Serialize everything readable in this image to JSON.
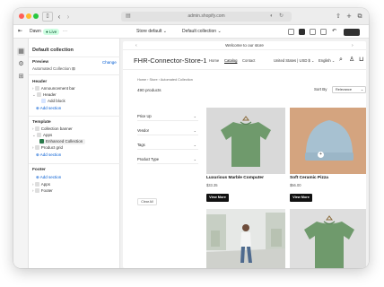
{
  "browser": {
    "url": "admin.shopify.com",
    "back_icon": "chevron-left-icon",
    "forward_icon": "chevron-right-icon",
    "sidebar_toggle_icon": "sidebar-icon",
    "share_icon": "share-icon",
    "new_tab_icon": "plus-icon",
    "tabs_icon": "tabs-overview-icon"
  },
  "toolbar": {
    "theme_name": "Dawn",
    "live_badge": "● Live",
    "more_label": "···",
    "store_selector": "Store default ⌄",
    "template_selector": "Default collection ⌄"
  },
  "rail": {
    "icons": [
      "sections-icon",
      "settings-icon",
      "apps-icon"
    ]
  },
  "sidebar": {
    "title": "Default collection",
    "preview_label": "Preview",
    "preview_change": "Change",
    "preview_value": "Automated Collection ⊠",
    "header_section": "Header",
    "header_items": [
      {
        "label": "Announcement bar",
        "icon": "announcement-icon"
      },
      {
        "label": "Header",
        "icon": "header-icon"
      },
      {
        "label": "Add block",
        "icon": "add-block-icon"
      }
    ],
    "header_add": "Add section",
    "template_section": "Template",
    "template_items": [
      {
        "label": "Collection banner",
        "icon": "banner-icon"
      },
      {
        "label": "Apps",
        "icon": "apps-block-icon"
      },
      {
        "label": "Enhanced Collection",
        "icon": "collection-icon"
      },
      {
        "label": "Product grid",
        "icon": "grid-icon"
      }
    ],
    "template_add": "Add section",
    "footer_section": "Footer",
    "footer_add": "Add section",
    "footer_items": [
      {
        "label": "Apps",
        "icon": "apps-block-icon"
      },
      {
        "label": "Footer",
        "icon": "footer-icon"
      }
    ]
  },
  "store": {
    "announcement": "Welcome to our store",
    "name": "FHR-Connector-Store-1",
    "nav": [
      "Home",
      "Catalog",
      "Contact"
    ],
    "country": "United States | USD $ ⌄",
    "language": "English ⌄",
    "breadcrumb": "Home  ›  Store  ›  Automated Collection",
    "product_count": "490 products",
    "sort_label": "Sort By",
    "sort_value": "Relevance",
    "filters": [
      "Price Up",
      "Vendor",
      "Tags",
      "Product Type"
    ],
    "clear_all": "Clear All",
    "products": [
      {
        "title": "Luxurious Marble Computer",
        "price": "$33.35",
        "button": "View More"
      },
      {
        "title": "Soft Ceramic Pizza",
        "price": "$56.00",
        "button": "View More"
      }
    ]
  },
  "colors": {
    "accent": "#005bd3",
    "live_bg": "#cdfee1",
    "button_bg": "#111111",
    "shirt_green": "#6f9a6c",
    "beanie_blue": "#a7c1d1"
  }
}
